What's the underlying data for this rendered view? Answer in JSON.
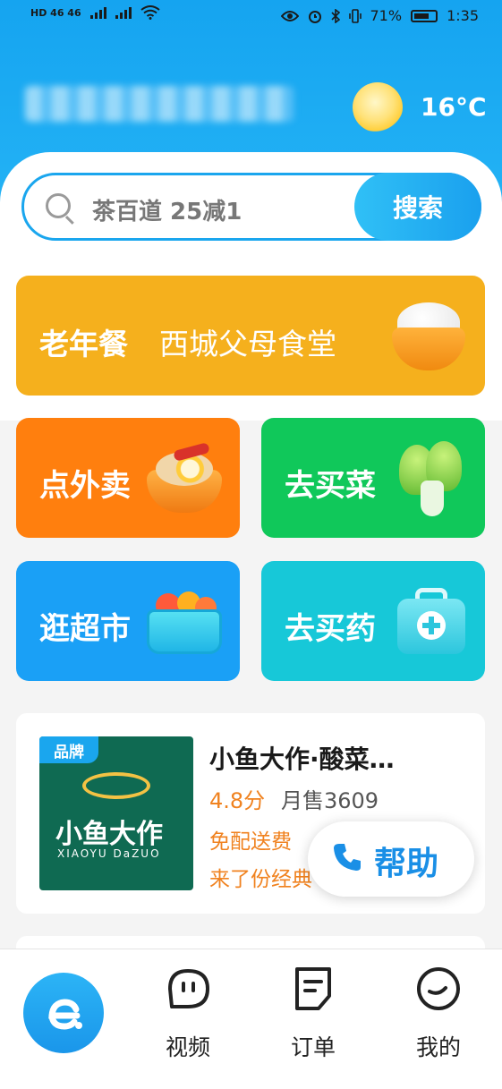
{
  "status_bar": {
    "network_left": "HD 46 46",
    "battery": "71%",
    "time": "1:35"
  },
  "header": {
    "weather_icon": "sun-icon",
    "temperature": "16°C"
  },
  "search": {
    "placeholder": "茶百道 25减1",
    "button_label": "搜索"
  },
  "elder_meal": {
    "label": "老年餐",
    "place": "西城父母食堂"
  },
  "categories": [
    {
      "label": "点外卖",
      "icon": "takeout-bowl-icon",
      "color": "#ff7f0e"
    },
    {
      "label": "去买菜",
      "icon": "vegetable-icon",
      "color": "#10c85a"
    },
    {
      "label": "逛超市",
      "icon": "basket-icon",
      "color": "#1aa0f6"
    },
    {
      "label": "去买药",
      "icon": "medicine-kit-icon",
      "color": "#17c8d8"
    }
  ],
  "shop": {
    "tag": "品牌",
    "logo_text": "小鱼大作",
    "logo_text_en": "XIAOYU DaZUO",
    "name": "小鱼大作·酸菜…",
    "rating": "4.8分",
    "monthly_sales": "月售3609",
    "line3": "免配送费",
    "line4": "来了份经典"
  },
  "help_button": {
    "label": "帮助"
  },
  "tab_bar": {
    "items": [
      {
        "label": "视频"
      },
      {
        "label": "订单"
      },
      {
        "label": "我的"
      }
    ]
  },
  "colors": {
    "brand_blue": "#1aa6ee",
    "accent_orange": "#f0821f"
  }
}
